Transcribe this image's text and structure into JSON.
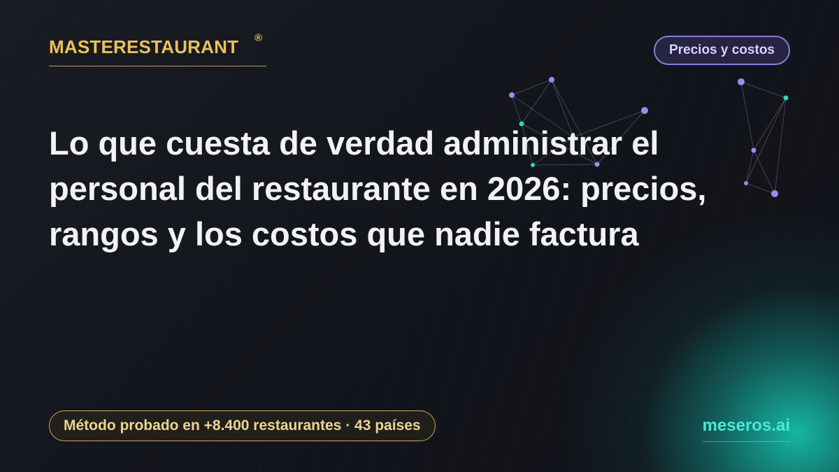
{
  "brand": {
    "name": "MASTERESTAURANT",
    "registered_mark": "®"
  },
  "category_tag": "Precios y costos",
  "headline": "Lo que cuesta de verdad administrar el personal del restaurante en 2026: precios, rangos y los costos que nadie factura",
  "footer": {
    "proof_badge": "Método probado en +8.400 restaurantes · 43 países",
    "site": "meseros.ai"
  },
  "colors": {
    "background": "#12141b",
    "brand_gold": "#e9c15d",
    "tag_purple": "#8b7cd8",
    "teal_accent": "#4fe6d6",
    "headline_text": "#f2f2f4"
  },
  "decorations": {
    "network_icon": "constellation-network-graphic",
    "node_colors": [
      "#9a8cf0",
      "#2fd6c0"
    ]
  }
}
